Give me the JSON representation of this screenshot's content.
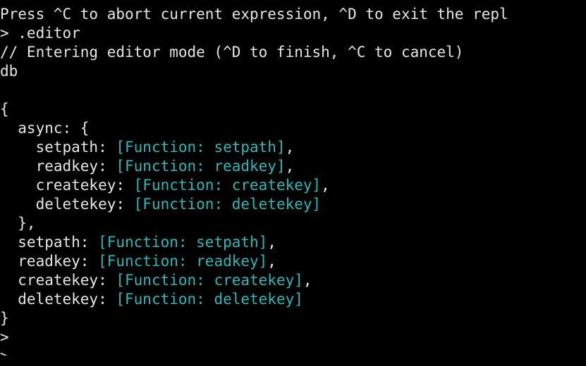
{
  "terminal": {
    "banner": "Press ^C to abort current expression, ^D to exit the repl",
    "editor_command": "> .editor",
    "editor_hint": "// Entering editor mode (^D to finish, ^C to cancel)",
    "input_db": "db",
    "blank": "",
    "open_brace": "{",
    "async_key": "  async: {",
    "async_setpath_key": "    setpath: ",
    "async_setpath_val": "[Function: setpath]",
    "async_setpath_sep": ",",
    "async_readkey_key": "    readkey: ",
    "async_readkey_val": "[Function: readkey]",
    "async_readkey_sep": ",",
    "async_createkey_key": "    createkey: ",
    "async_createkey_val": "[Function: createkey]",
    "async_createkey_sep": ",",
    "async_deletekey_key": "    deletekey: ",
    "async_deletekey_val": "[Function: deletekey]",
    "async_close": "  },",
    "setpath_key": "  setpath: ",
    "setpath_val": "[Function: setpath]",
    "setpath_sep": ",",
    "readkey_key": "  readkey: ",
    "readkey_val": "[Function: readkey]",
    "readkey_sep": ",",
    "createkey_key": "  createkey: ",
    "createkey_val": "[Function: createkey]",
    "createkey_sep": ",",
    "deletekey_key": "  deletekey: ",
    "deletekey_val": "[Function: deletekey]",
    "close_brace": "}",
    "prompt_1": ">",
    "prompt_2": ">"
  },
  "colors": {
    "background": "#000000",
    "text": "#e6e6e6",
    "function_value": "#2fb8b8"
  }
}
